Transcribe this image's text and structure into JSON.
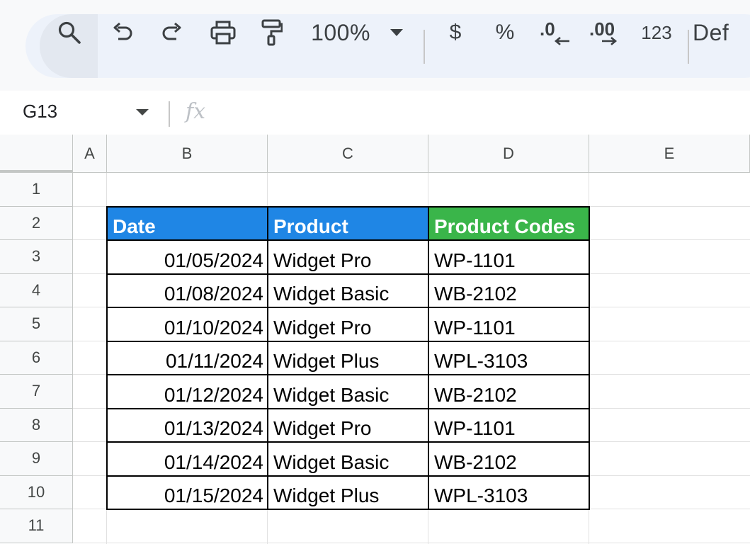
{
  "toolbar": {
    "icons": [
      "search-icon",
      "undo-icon",
      "redo-icon",
      "print-icon",
      "paint-format-icon"
    ],
    "zoom": "100%",
    "currency_label": "$",
    "percent_label": "%",
    "decrease_decimal_label": ".0",
    "increase_decimal_label": ".00",
    "number_format_label": "123",
    "font_label": "Def"
  },
  "formula_bar": {
    "name_box": "G13",
    "fx_label": "fx",
    "formula": ""
  },
  "columns": [
    "A",
    "B",
    "C",
    "D",
    "E"
  ],
  "rows": [
    "1",
    "2",
    "3",
    "4",
    "5",
    "6",
    "7",
    "8",
    "9",
    "10",
    "11"
  ],
  "table": {
    "headers": [
      "Date",
      "Product",
      "Product Codes"
    ],
    "header_colors": [
      "#1f86e5",
      "#1f86e5",
      "#3ab54a"
    ],
    "rows": [
      [
        "01/05/2024",
        "Widget Pro",
        "WP-1101"
      ],
      [
        "01/08/2024",
        "Widget Basic",
        "WB-2102"
      ],
      [
        "01/10/2024",
        "Widget Pro",
        "WP-1101"
      ],
      [
        "01/11/2024",
        "Widget Plus",
        "WPL-3103"
      ],
      [
        "01/12/2024",
        "Widget Basic",
        "WB-2102"
      ],
      [
        "01/13/2024",
        "Widget Pro",
        "WP-1101"
      ],
      [
        "01/14/2024",
        "Widget Basic",
        "WB-2102"
      ],
      [
        "01/15/2024",
        "Widget Plus",
        "WPL-3103"
      ]
    ]
  }
}
